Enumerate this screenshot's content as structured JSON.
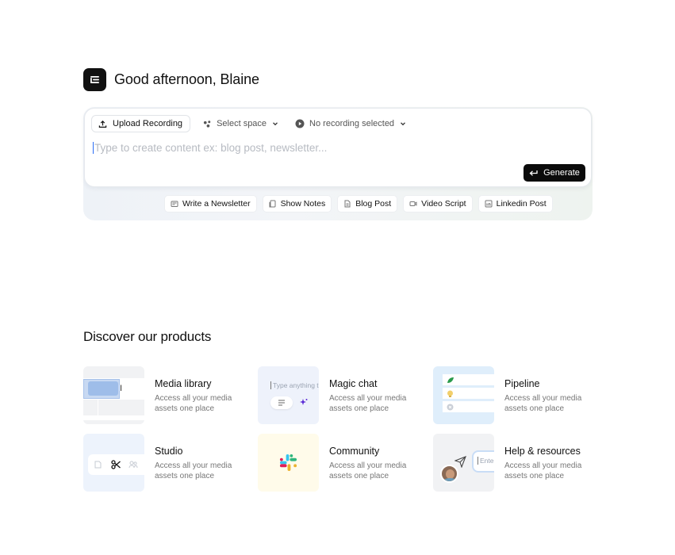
{
  "greeting": "Good afternoon, Blaine",
  "composer": {
    "upload_label": "Upload Recording",
    "space_label": "Select space",
    "recording_label": "No recording selected",
    "prompt_placeholder": "Type to create content ex: blog post, newsletter...",
    "generate_label": "Generate"
  },
  "chips": [
    {
      "label": "Write a Newsletter",
      "icon": "newsletter-icon"
    },
    {
      "label": "Show Notes",
      "icon": "notes-icon"
    },
    {
      "label": "Blog Post",
      "icon": "document-icon"
    },
    {
      "label": "Video Script",
      "icon": "video-icon"
    },
    {
      "label": "Linkedin Post",
      "icon": "linkedin-icon"
    }
  ],
  "discover": {
    "title": "Discover our products",
    "products": [
      {
        "title": "Media library",
        "desc": "Access all your media assets one place"
      },
      {
        "title": "Magic chat",
        "desc": "Access all your media assets one place",
        "thumb_text": "Type anything to"
      },
      {
        "title": "Pipeline",
        "desc": "Access all your media assets one place"
      },
      {
        "title": "Studio",
        "desc": "Access all your media assets one place"
      },
      {
        "title": "Community",
        "desc": "Access all your media assets one place"
      },
      {
        "title": "Help & resources",
        "desc": "Access all your media assets one place",
        "thumb_text": "Ente"
      }
    ]
  },
  "colors": {
    "accent": "#0b0b0b",
    "media_thumb": "#f1f2f4",
    "chat_thumb": "#eef2fb",
    "pipeline_thumb": "#dfeefb",
    "studio_thumb": "#edf3fc",
    "community_thumb": "#fffbea",
    "help_thumb": "#f1f2f4"
  }
}
